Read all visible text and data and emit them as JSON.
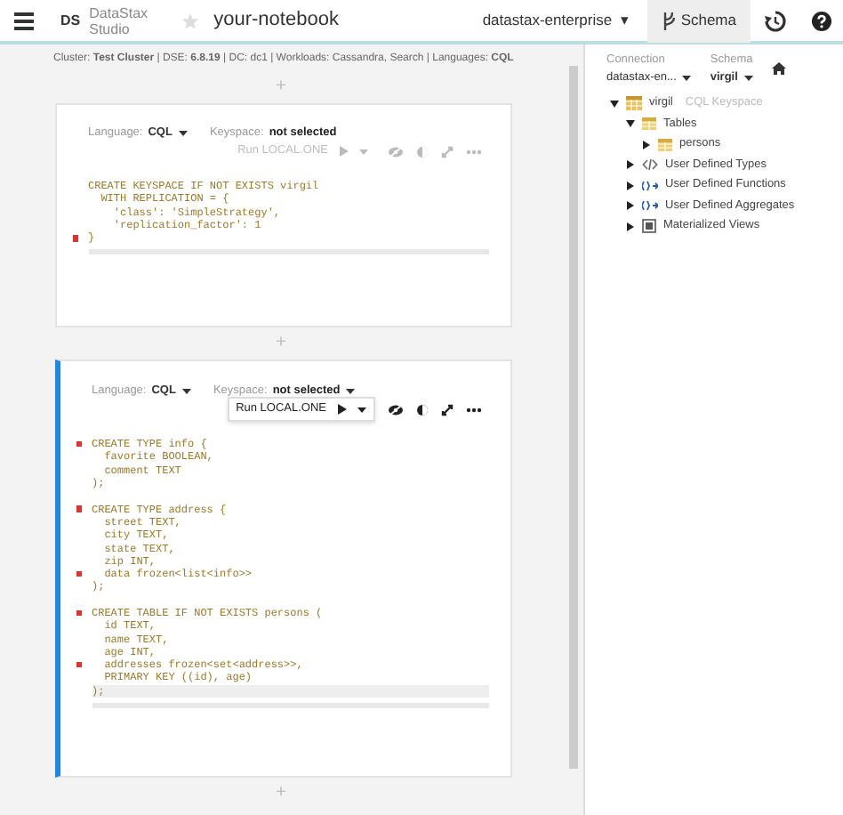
{
  "header": {
    "logo": "DS",
    "product": [
      "DataStax",
      "Studio"
    ],
    "favorite": false,
    "notebook": "your-notebook",
    "connection": "datastax-enterprise",
    "caret": "▾",
    "schema_button": {
      "label": "Schema",
      "selected": true
    }
  },
  "cluster_info": "Cluster: **Test Cluster** | DSE: **6.8.19** | DC: dc1 | Workloads: Cassandra, Search | Languages: **CQL**",
  "add": "+",
  "cells": [
    {
      "active": false,
      "language_label": "Language:",
      "language": "CQL",
      "keyspace_label": "Keyspace:",
      "keyspace": "not selected",
      "run": "Run LOCAL.ONE",
      "lines": [
        {
          "text": "CREATE KEYSPACE IF NOT EXISTS virgil",
          "error": false
        },
        {
          "text": "  WITH REPLICATION = {",
          "error": false
        },
        {
          "text": "    'class': 'SimpleStrategy',",
          "error": false
        },
        {
          "text": "    'replication_factor': 1",
          "error": false
        },
        {
          "text": "}",
          "error": true
        }
      ]
    },
    {
      "active": true,
      "language_label": "Language:",
      "language": "CQL",
      "keyspace_label": "Keyspace:",
      "keyspace": "not selected",
      "run": "Run LOCAL.ONE",
      "lines": [
        {
          "text": "CREATE TYPE info {",
          "error": true
        },
        {
          "text": "  favorite BOOLEAN,",
          "error": false
        },
        {
          "text": "  comment TEXT",
          "error": false
        },
        {
          "text": ");",
          "error": false
        },
        {
          "error": false
        },
        {
          "text": "CREATE TYPE address {",
          "error": true
        },
        {
          "text": "  street TEXT,",
          "error": false
        },
        {
          "text": "  city TEXT,",
          "error": false
        },
        {
          "text": "  state TEXT,",
          "error": false
        },
        {
          "text": "  zip INT,",
          "error": false
        },
        {
          "text": "  data frozen<list<info>>",
          "error": true
        },
        {
          "text": ");",
          "error": false
        },
        {
          "error": false
        },
        {
          "text": "CREATE TABLE IF NOT EXISTS persons (",
          "error": true
        },
        {
          "text": "  id TEXT,",
          "error": false
        },
        {
          "text": "  name TEXT,",
          "error": false
        },
        {
          "text": "  age INT,",
          "error": false
        },
        {
          "text": "  addresses frozen<set<address>>,",
          "error": true
        },
        {
          "text": "  PRIMARY KEY ((id), age)",
          "error": false
        },
        {
          "text": ");",
          "error": false
        }
      ]
    }
  ],
  "schema_panel": {
    "connection_label": "Connection",
    "connection": "datastax-en...",
    "schema_label": "Schema",
    "schema": "virgil",
    "tree": [
      {
        "label": "virgil",
        "note": "CQL Keyspace",
        "kind": "keyspace",
        "expanded": true,
        "children": [
          {
            "label": "Tables",
            "kind": "table",
            "expanded": true,
            "children": [
              {
                "label": "persons",
                "kind": "table",
                "expanded": false
              }
            ]
          },
          {
            "label": "User Defined Types",
            "kind": "type",
            "expanded": false
          },
          {
            "label": "User Defined Functions",
            "kind": "function",
            "expanded": false
          },
          {
            "label": "User Defined Aggregates",
            "kind": "function",
            "expanded": false
          },
          {
            "label": "Materialized Views",
            "kind": "view",
            "expanded": false
          }
        ]
      }
    ]
  }
}
